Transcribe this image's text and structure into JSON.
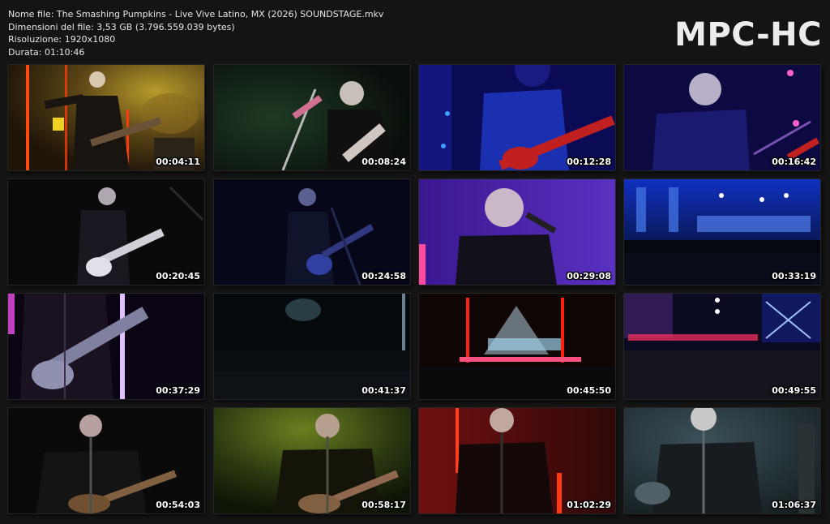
{
  "file_info": {
    "name_line": "Nome file: The Smashing Pumpkins - Live Vive Latino, MX (2026) SOUNDSTAGE.mkv",
    "size_line": "Dimensioni del file: 3,53 GB (3.796.559.039 bytes)",
    "resolution_line": "Risoluzione: 1920x1080",
    "duration_line": "Durata: 01:10:46"
  },
  "logo": "MPC-HC",
  "thumbnails": [
    {
      "timestamp": "00:04:11",
      "scene": "guitarist-amber-stage"
    },
    {
      "timestamp": "00:08:24",
      "scene": "singer-at-mic-green"
    },
    {
      "timestamp": "00:12:28",
      "scene": "guitar-closeup-blue"
    },
    {
      "timestamp": "00:16:42",
      "scene": "bassist-blue-lights"
    },
    {
      "timestamp": "00:20:45",
      "scene": "guitarist-white-guitar-dark"
    },
    {
      "timestamp": "00:24:58",
      "scene": "guitarist-dark-blue"
    },
    {
      "timestamp": "00:29:08",
      "scene": "singer-purple"
    },
    {
      "timestamp": "00:33:19",
      "scene": "wide-stage-crowd-blue"
    },
    {
      "timestamp": "00:37:29",
      "scene": "guitar-closeup-purple"
    },
    {
      "timestamp": "00:41:37",
      "scene": "dark-crowd"
    },
    {
      "timestamp": "00:45:50",
      "scene": "wide-stage-red-lights"
    },
    {
      "timestamp": "00:49:55",
      "scene": "wide-stage-crowd-red-blue"
    },
    {
      "timestamp": "00:54:03",
      "scene": "singer-acoustic-dark"
    },
    {
      "timestamp": "00:58:17",
      "scene": "singer-acoustic-green"
    },
    {
      "timestamp": "01:02:29",
      "scene": "singer-red-stage"
    },
    {
      "timestamp": "01:06:37",
      "scene": "singer-teal-grey"
    }
  ]
}
